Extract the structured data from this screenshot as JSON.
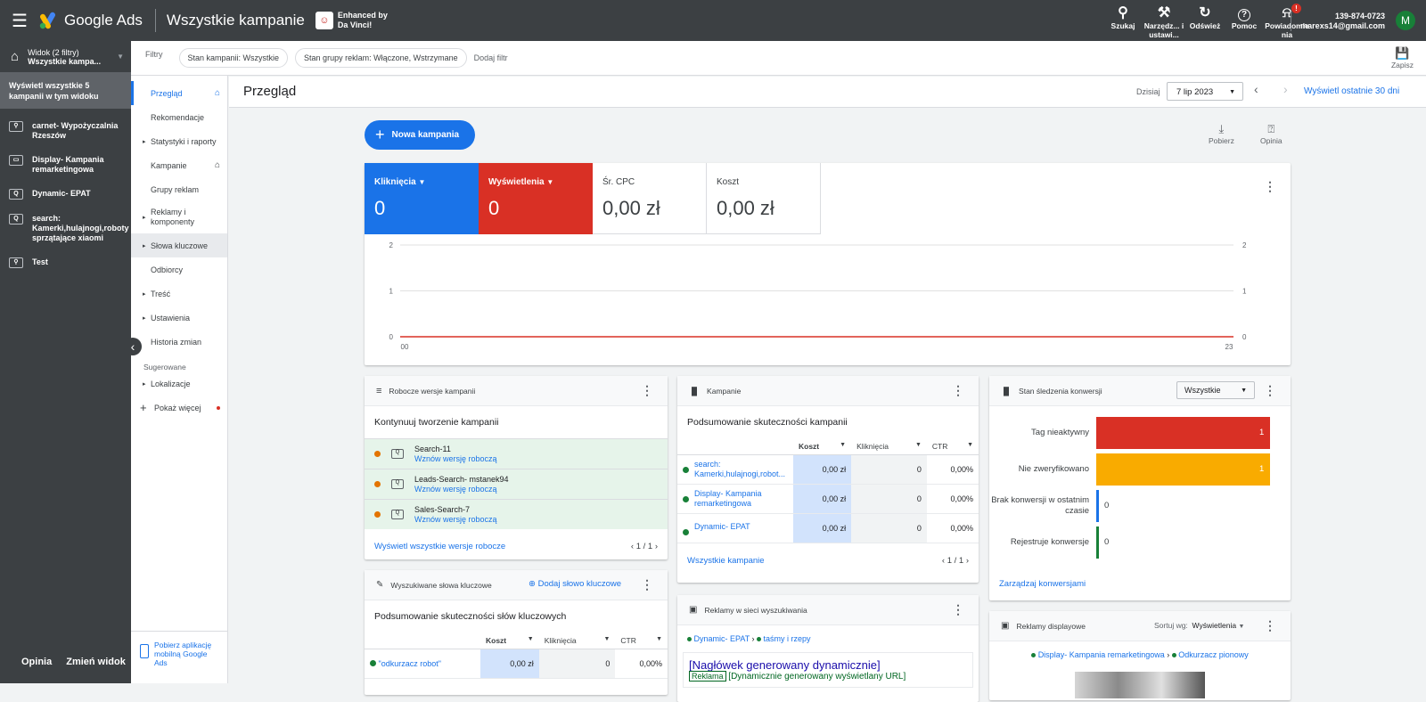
{
  "app": {
    "name": "Google Ads",
    "page_title": "Wszystkie kampanie",
    "enhanced": "Enhanced by",
    "enhanced2": "Da Vinci!"
  },
  "topbar": {
    "icons": [
      {
        "label": "Szukaj",
        "icon": "search-icon",
        "glyph": "⚲"
      },
      {
        "label": "Narzędz... i ustawi...",
        "icon": "wrench-icon",
        "glyph": "🔧"
      },
      {
        "label": "Odśwież",
        "icon": "refresh-icon",
        "glyph": "↻"
      },
      {
        "label": "Pomoc",
        "icon": "help-icon",
        "glyph": "?"
      },
      {
        "label": "Powiadomie nia",
        "icon": "bell-icon",
        "glyph": "🔔"
      }
    ],
    "notif_badge": "!",
    "account_id": "139-874-0723",
    "account_email": "marexs14@gmail.com",
    "avatar_letter": "M"
  },
  "sidebar": {
    "view_line1": "Widok (2 filtry)",
    "view_line2": "Wszystkie kampa...",
    "show_all": "Wyświetl wszystkie 5 kampanii w tym widoku",
    "campaigns": [
      {
        "name": "carnet- Wypożyczalnia Rzeszów",
        "icon": "search-campaign-icon"
      },
      {
        "name": "Display- Kampania remarketingowa",
        "icon": "display-campaign-icon"
      },
      {
        "name": "Dynamic- EPAT",
        "icon": "dynamic-search-campaign-icon"
      },
      {
        "name": "search: Kamerki,hulajnogi,roboty sprzątające xiaomi",
        "icon": "dynamic-search-campaign-icon"
      },
      {
        "name": "Test",
        "icon": "search-campaign-icon"
      }
    ],
    "opinion": "Opinia",
    "change_view": "Zmień widok"
  },
  "nav": {
    "items": [
      {
        "label": "Przegląd",
        "arrow": "",
        "home": "⌂"
      },
      {
        "label": "Rekomendacje",
        "arrow": "",
        "home": ""
      },
      {
        "label": "Statystyki i raporty",
        "arrow": "▸",
        "home": ""
      },
      {
        "label": "Kampanie",
        "arrow": "",
        "home": "⌂"
      },
      {
        "label": "Grupy reklam",
        "arrow": "",
        "home": ""
      },
      {
        "label": "Reklamy i komponenty",
        "arrow": "▸",
        "home": ""
      },
      {
        "label": "Słowa kluczowe",
        "arrow": "▸",
        "home": ""
      },
      {
        "label": "Odbiorcy",
        "arrow": "",
        "home": ""
      },
      {
        "label": "Treść",
        "arrow": "▸",
        "home": ""
      },
      {
        "label": "Ustawienia",
        "arrow": "▸",
        "home": ""
      },
      {
        "label": "Historia zmian",
        "arrow": "",
        "home": ""
      }
    ],
    "suggested": "Sugerowane",
    "locations": "Lokalizacje",
    "show_more": "Pokaż więcej",
    "download_app": "Pobierz aplikację mobilną Google Ads"
  },
  "filters": {
    "label": "Filtry",
    "chips": [
      "Stan kampanii: Wszystkie",
      "Stan grupy reklam: Włączone, Wstrzymane"
    ],
    "add": "Dodaj filtr",
    "save": "Zapisz"
  },
  "header": {
    "title": "Przegląd",
    "today": "Dzisiaj",
    "date": "7 lip 2023",
    "last30": "Wyświetl ostatnie 30 dni"
  },
  "actions": {
    "new_campaign": "Nowa kampania",
    "download": "Pobierz",
    "feedback": "Opinia"
  },
  "metrics": [
    {
      "label": "Kliknięcia",
      "value": "0"
    },
    {
      "label": "Wyświetlenia",
      "value": "0"
    },
    {
      "label": "Śr. CPC",
      "value": "0,00 zł"
    },
    {
      "label": "Koszt",
      "value": "0,00 zł"
    }
  ],
  "chart_data": {
    "type": "line",
    "x": [
      "00",
      "23"
    ],
    "series": [
      {
        "values": [
          0,
          0
        ],
        "color": "#d93025"
      }
    ],
    "yticks_left": [
      "0",
      "1",
      "2"
    ],
    "yticks_right": [
      "0",
      "1",
      "2"
    ],
    "ylim": [
      0,
      2
    ],
    "grid": true
  },
  "drafts": {
    "title": "Robocze wersje kampanii",
    "subtitle": "Kontynuuj tworzenie kampanii",
    "rows": [
      {
        "name": "Search-11",
        "link": "Wznów wersję roboczą"
      },
      {
        "name": "Leads-Search- mstanek94",
        "link": "Wznów wersję roboczą"
      },
      {
        "name": "Sales-Search-7",
        "link": "Wznów wersję roboczą"
      }
    ],
    "footer": "Wyświetl wszystkie wersje robocze",
    "page": "1 / 1"
  },
  "campaigns_card": {
    "title": "Kampanie",
    "subtitle": "Podsumowanie skuteczności kampanii",
    "cols": [
      "Koszt",
      "Kliknięcia",
      "CTR"
    ],
    "rows": [
      {
        "name": "search: Kamerki,hulajnogi,robot...",
        "cost": "0,00 zł",
        "clicks": "0",
        "ctr": "0,00%"
      },
      {
        "name": "Display- Kampania remarketingowa",
        "cost": "0,00 zł",
        "clicks": "0",
        "ctr": "0,00%"
      },
      {
        "name": "Dynamic- EPAT",
        "cost": "0,00 zł",
        "clicks": "0",
        "ctr": "0,00%"
      }
    ],
    "footer": "Wszystkie kampanie",
    "page": "1 / 1"
  },
  "conversion": {
    "title": "Stan śledzenia konwersji",
    "filter": "Wszystkie",
    "rows": [
      {
        "label": "Tag nieaktywny",
        "value": "1",
        "color": "#d93025",
        "fill": 1
      },
      {
        "label": "Nie zweryfikowano",
        "value": "1",
        "color": "#f9ab00",
        "fill": 1
      },
      {
        "label": "Brak konwersji w ostatnim czasie",
        "value": "0",
        "color": "#1a73e8",
        "fill": 0
      },
      {
        "label": "Rejestruje konwersje",
        "value": "0",
        "color": "#188038",
        "fill": 0
      }
    ],
    "footer": "Zarządzaj konwersjami"
  },
  "keywords": {
    "title": "Wyszukiwane słowa kluczowe",
    "add": "Dodaj słowo kluczowe",
    "subtitle": "Podsumowanie skuteczności słów kluczowych",
    "cols": [
      "Koszt",
      "Kliknięcia",
      "CTR"
    ],
    "rows": [
      {
        "name": "\"odkurzacz robot\"",
        "cost": "0,00 zł",
        "clicks": "0",
        "ctr": "0,00%"
      }
    ]
  },
  "search_ads": {
    "title": "Reklamy w sieci wyszukiwania",
    "crumb1": "Dynamic- EPAT",
    "crumb2": "taśmy i rzepy",
    "headline": "[Nagłówek generowany dynamicznie]",
    "ad_label": "Reklama",
    "url": "[Dynamicznie generowany wyświetlany URL]"
  },
  "display_ads": {
    "title": "Reklamy displayowe",
    "sort_label": "Sortuj wg:",
    "sort_value": "Wyświetlenia",
    "crumb1": "Display- Kampania remarketingowa",
    "crumb2": "Odkurzacz pionowy"
  }
}
